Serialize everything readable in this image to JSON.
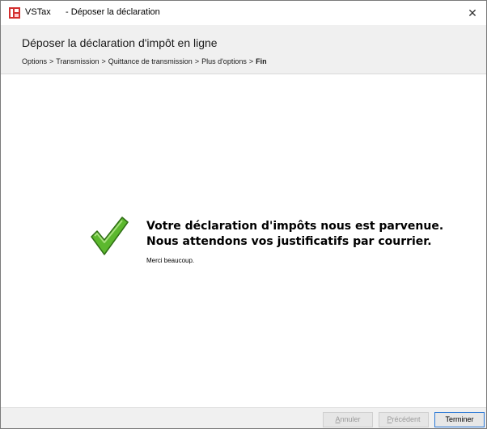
{
  "window": {
    "app_name": "VSTax",
    "title": "- Déposer la déclaration",
    "close_glyph": "✕"
  },
  "header": {
    "title": "Déposer la déclaration d'impôt en ligne",
    "breadcrumb": [
      "Options",
      "Transmission",
      "Quittance de transmission",
      "Plus d'options"
    ],
    "breadcrumb_separator": ">",
    "breadcrumb_current": "Fin"
  },
  "content": {
    "icon": "check-icon",
    "message_line1": "Votre déclaration d'impôts nous est parvenue.",
    "message_line2": "Nous attendons vos justificatifs par courrier.",
    "thanks": "Merci beaucoup."
  },
  "footer": {
    "cancel_first": "A",
    "cancel_rest": "nnuler",
    "prev_first": "P",
    "prev_rest": "récédent",
    "finish": "Terminer"
  },
  "colors": {
    "check_green": "#5cb82e",
    "check_border": "#2f6e15",
    "app_icon_red": "#d32f2f",
    "focus_blue": "#2b78d6"
  }
}
